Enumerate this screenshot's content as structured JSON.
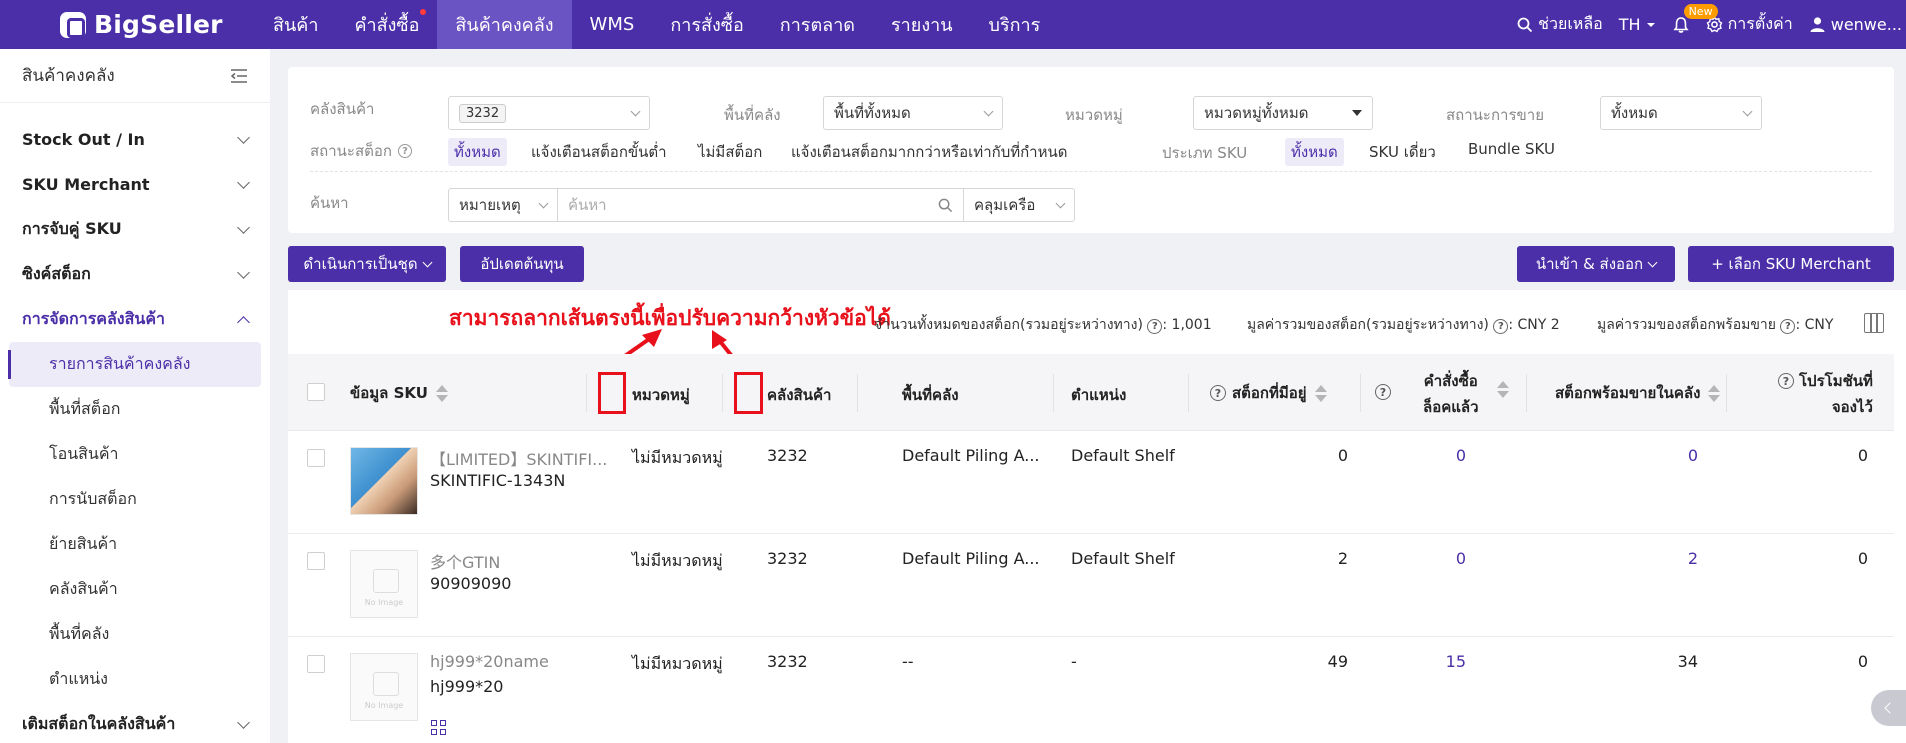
{
  "header": {
    "brand": "BigSeller",
    "nav": [
      {
        "label": "สินค้า"
      },
      {
        "label": "คำสั่งซื้อ"
      },
      {
        "label": "สินค้าคงคลัง"
      },
      {
        "label": "WMS"
      },
      {
        "label": "การสั่งซื้อ"
      },
      {
        "label": "การตลาด"
      },
      {
        "label": "รายงาน"
      },
      {
        "label": "บริการ"
      }
    ],
    "help": "ช่วยเหลือ",
    "lang": "TH",
    "new_badge": "New",
    "settings": "การตั้งค่า",
    "user": "wenwe..."
  },
  "sidebar": {
    "title": "สินค้าคงคลัง",
    "groups": [
      {
        "label": "Stock Out / In"
      },
      {
        "label": "SKU Merchant"
      },
      {
        "label": "การจับคู่ SKU"
      },
      {
        "label": "ซิงค์สต็อก"
      },
      {
        "label": "การจัดการคลังสินค้า"
      }
    ],
    "subitems": [
      {
        "label": "รายการสินค้าคงคลัง"
      },
      {
        "label": "พื้นที่สต็อก"
      },
      {
        "label": "โอนสินค้า"
      },
      {
        "label": "การนับสต็อก"
      },
      {
        "label": "ย้ายสินค้า"
      },
      {
        "label": "คลังสินค้า"
      },
      {
        "label": "พื้นที่คลัง"
      },
      {
        "label": "ตำแหน่ง"
      }
    ],
    "bottom_group": "เติมสต็อกในคลังสินค้า"
  },
  "filters": {
    "warehouse_label": "คลังสินค้า",
    "warehouse_value": "3232",
    "zone_label": "พื้นที่คลัง",
    "zone_value": "พื้นที่ทั้งหมด",
    "category_label": "หมวดหมู่",
    "category_value": "หมวดหมู่ทั้งหมด",
    "sale_status_label": "สถานะการขาย",
    "sale_status_value": "ทั้งหมด",
    "stock_status_label": "สถานะสต็อก",
    "stock_options": [
      "ทั้งหมด",
      "แจ้งเตือนสต็อกขั้นต่ำ",
      "ไม่มีสต็อก",
      "แจ้งเตือนสต็อกมากกว่าหรือเท่ากับที่กำหนด"
    ],
    "sku_type_label": "ประเภท SKU",
    "sku_type_options": [
      "ทั้งหมด",
      "SKU เดี่ยว",
      "Bundle SKU"
    ],
    "search_label": "ค้นหา",
    "search_field": "หมายเหตุ",
    "search_placeholder": "ค้นหา",
    "search_mode": "คลุมเครือ"
  },
  "toolbar": {
    "bulk_label": "ดำเนินการเป็นชุด",
    "update_cost_label": "อัปเดตต้นทุน",
    "import_export_label": "นำเข้า & ส่งออก",
    "select_sku_label": "+ เลือก SKU Merchant"
  },
  "summary": {
    "annotation": "สามารถลากเส้นตรงนี้เพื่อปรับความกว้างหัวข้อได้",
    "total_stock_label": "จำนวนทั้งหมดของสต็อก(รวมอยู่ระหว่างทาง)",
    "total_stock_value": ": 1,001",
    "stock_value_label": "มูลค่ารวมของสต็อก(รวมอยู่ระหว่างทาง)",
    "stock_value_value": ": CNY 2",
    "sellable_value_label": "มูลค่ารวมของสต็อกพร้อมขาย",
    "sellable_value_value": ": CNY"
  },
  "table": {
    "columns": {
      "sku_info": "ข้อมูล SKU",
      "category": "หมวดหมู่",
      "warehouse": "คลังสินค้า",
      "zone": "พื้นที่คลัง",
      "location": "ตำแหน่ง",
      "on_hand": "สต็อกที่มีอยู่",
      "locked_line1": "คำสั่งซื้อ",
      "locked_line2": "ล็อคแล้ว",
      "sellable": "สต็อกพร้อมขายในคลัง",
      "promo_line1": "โปรโมชันที่",
      "promo_line2": "จองไว้"
    },
    "rows": [
      {
        "name": "【LIMITED】SKINTIFI...",
        "sku": "SKINTIFIC-1343N",
        "category": "ไม่มีหมวดหมู่",
        "warehouse": "3232",
        "zone": "Default Piling A...",
        "location": "Default Shelf",
        "on_hand": "0",
        "locked": "0",
        "sellable": "0",
        "promo": "0"
      },
      {
        "name": "多个GTIN",
        "sku": "90909090",
        "category": "ไม่มีหมวดหมู่",
        "warehouse": "3232",
        "zone": "Default Piling A...",
        "location": "Default Shelf",
        "on_hand": "2",
        "locked": "0",
        "sellable": "2",
        "promo": "0"
      },
      {
        "name": "hj999*20name",
        "sku": "hj999*20",
        "category": "ไม่มีหมวดหมู่",
        "warehouse": "3232",
        "zone": "--",
        "location": "-",
        "on_hand": "49",
        "locked": "15",
        "sellable": "34",
        "promo": "0"
      }
    ],
    "no_image_text": "No Image"
  }
}
